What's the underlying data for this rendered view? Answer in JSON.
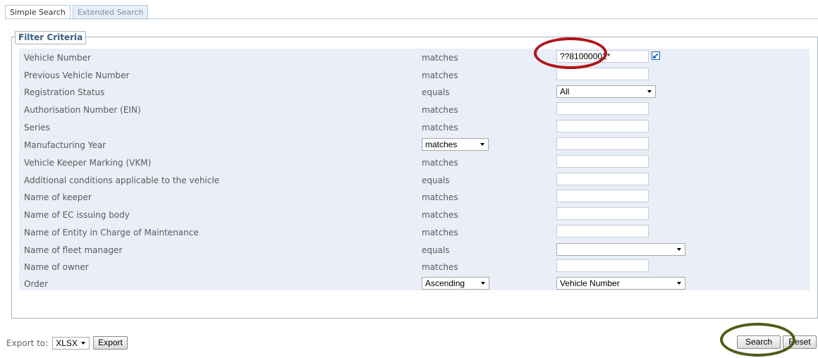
{
  "tabs": [
    {
      "label": "Simple Search"
    },
    {
      "label": "Extended Search"
    }
  ],
  "filter": {
    "legend": "Filter Criteria",
    "rows": [
      {
        "label": "Vehicle Number",
        "op": "matches",
        "value": "??81000002*"
      },
      {
        "label": "Previous Vehicle Number",
        "op": "matches",
        "value": ""
      },
      {
        "label": "Registration Status",
        "op": "equals",
        "value": "All"
      },
      {
        "label": "Authorisation Number (EIN)",
        "op": "matches",
        "value": ""
      },
      {
        "label": "Series",
        "op": "matches",
        "value": ""
      },
      {
        "label": "Manufacturing Year",
        "op": "matches",
        "value": ""
      },
      {
        "label": "Vehicle Keeper Marking (VKM)",
        "op": "matches",
        "value": ""
      },
      {
        "label": "Additional conditions applicable to the vehicle",
        "op": "equals",
        "value": ""
      },
      {
        "label": "Name of keeper",
        "op": "matches",
        "value": ""
      },
      {
        "label": "Name of EC issuing body",
        "op": "matches",
        "value": ""
      },
      {
        "label": "Name of Entity in Charge of Maintenance",
        "op": "matches",
        "value": ""
      },
      {
        "label": "Name of fleet manager",
        "op": "equals",
        "value": ""
      },
      {
        "label": "Name of owner",
        "op": "matches",
        "value": ""
      },
      {
        "label": "Order",
        "op": "Ascending",
        "value": "Vehicle Number"
      }
    ]
  },
  "export": {
    "label": "Export to:",
    "format": "XLSX",
    "button": "Export"
  },
  "actions": {
    "search": "Search",
    "reset": "Reset"
  },
  "colors": {
    "highlight_red": "#b0141a",
    "highlight_green": "#4e5d17",
    "grid_bg": "#e9eef7"
  }
}
